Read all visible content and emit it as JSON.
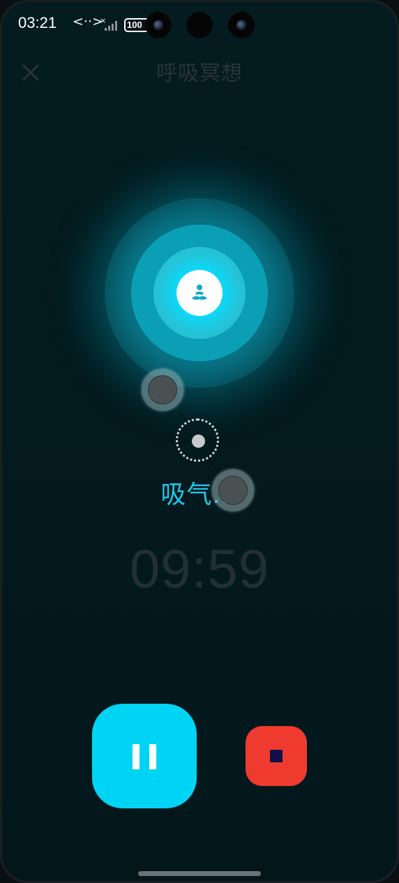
{
  "status_bar": {
    "time": "03:21",
    "dev_icon_text": "<··>",
    "battery": "100"
  },
  "header": {
    "title": "呼吸冥想",
    "close_icon": "close-icon"
  },
  "orb": {
    "center_icon": "meditation-icon",
    "accent_color": "#00d4f5"
  },
  "session": {
    "phase": "吸气...",
    "timer": "09:59"
  },
  "controls": {
    "pause_icon": "pause-icon",
    "stop_icon": "stop-icon",
    "pause_color": "#00d4f5",
    "stop_color": "#ef3a2f"
  }
}
